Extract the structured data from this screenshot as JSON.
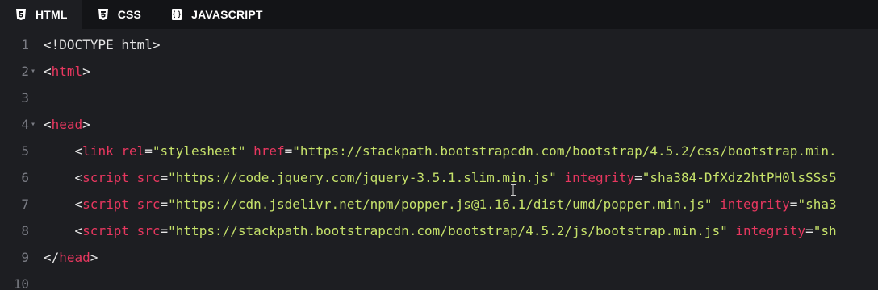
{
  "tabs": [
    {
      "label": "HTML",
      "icon": "html5-icon",
      "active": true
    },
    {
      "label": "CSS",
      "icon": "css3-icon",
      "active": false
    },
    {
      "label": "JAVASCRIPT",
      "icon": "javascript-icon",
      "active": false
    }
  ],
  "editor": {
    "line_numbers": [
      "1",
      "2",
      "3",
      "4",
      "5",
      "6",
      "7",
      "8",
      "9",
      "10"
    ],
    "lines": {
      "l1": {
        "text": "<!DOCTYPE html>"
      },
      "l2": {
        "open": "<",
        "tag": "html",
        "close": ">"
      },
      "l4": {
        "open": "<",
        "tag": "head",
        "close": ">"
      },
      "l5": {
        "indent": "    ",
        "open": "<",
        "tag": "link",
        "sp1": " ",
        "attr1": "rel",
        "eq1": "=",
        "val1": "\"stylesheet\"",
        "sp2": " ",
        "attr2": "href",
        "eq2": "=",
        "val2": "\"https://stackpath.bootstrapcdn.com/bootstrap/4.5.2/css/bootstrap.min."
      },
      "l6": {
        "indent": "    ",
        "open": "<",
        "tag": "script",
        "sp1": " ",
        "attr1": "src",
        "eq1": "=",
        "val1": "\"https://code.jquery.com/jquery-3.5.1.slim.min.js\"",
        "sp2": " ",
        "attr2": "integrity",
        "eq2": "=",
        "val2": "\"sha384-DfXdz2htPH0lsSSs5"
      },
      "l7": {
        "indent": "    ",
        "open": "<",
        "tag": "script",
        "sp1": " ",
        "attr1": "src",
        "eq1": "=",
        "val1": "\"https://cdn.jsdelivr.net/npm/popper.js@1.16.1/dist/umd/popper.min.js\"",
        "sp2": " ",
        "attr2": "integrity",
        "eq2": "=",
        "val2": "\"sha3"
      },
      "l8": {
        "indent": "    ",
        "open": "<",
        "tag": "script",
        "sp1": " ",
        "attr1": "src",
        "eq1": "=",
        "val1": "\"https://stackpath.bootstrapcdn.com/bootstrap/4.5.2/js/bootstrap.min.js\"",
        "sp2": " ",
        "attr2": "integrity",
        "eq2": "=",
        "val2": "\"sh"
      },
      "l9": {
        "open": "</",
        "tag": "head",
        "close": ">"
      }
    },
    "fold_marker": "▾",
    "colors": {
      "tag": "#e7375f",
      "string": "#c6e26a",
      "text": "#e6e6e6",
      "gutter": "#7a7c84",
      "background": "#1d1e22",
      "tabbar": "#131417"
    }
  }
}
